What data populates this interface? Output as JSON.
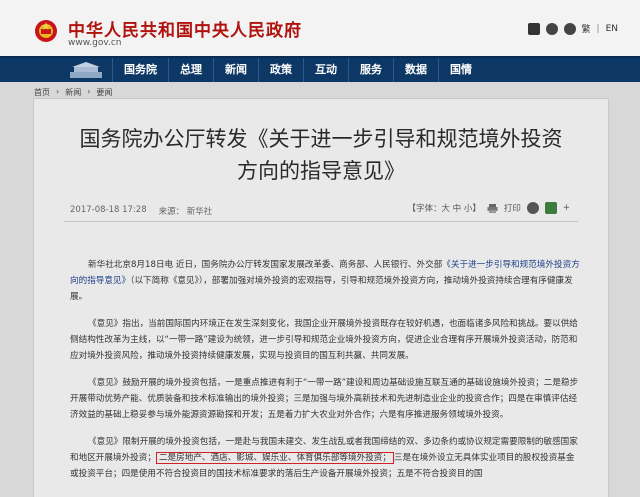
{
  "header": {
    "title": "中华人民共和国中央人民政府",
    "url": "www.gov.cn",
    "tools": {
      "lang_label": "繁",
      "lang_en": "EN"
    }
  },
  "nav": {
    "items": [
      {
        "label": "国务院"
      },
      {
        "label": "总理"
      },
      {
        "label": "新闻"
      },
      {
        "label": "政策"
      },
      {
        "label": "互动"
      },
      {
        "label": "服务"
      },
      {
        "label": "数据"
      },
      {
        "label": "国情"
      }
    ]
  },
  "breadcrumb": {
    "items": [
      "首页",
      "新闻",
      "要闻"
    ]
  },
  "article": {
    "title_line1": "国务院办公厅转发《关于进一步引导和规范境外投资",
    "title_line2": "方向的指导意见》",
    "date": "2017-08-18 17:28",
    "source": "来源： 新华社",
    "font_label": "【字体：大 中 小】",
    "print_label": "打印",
    "paragraphs": {
      "p1_text": "新华社北京8月18日电 近日，国务院办公厅转发国家发展改革委、商务部、人民银行、外交部",
      "p1_link": "《关于进一步引导和规范境外投资方向的指导意见》",
      "p1_text2": "（以下简称《意见》），部署加强对境外投资的宏观指导，引导和规范境外投资方向，推动境外投资持续合理有序健康发展。",
      "p2": "《意见》指出，当前国际国内环境正在发生深刻变化，我国企业开展境外投资既存在较好机遇，也面临诸多风险和挑战。要以供给侧结构性改革为主线，以“一带一路”建设为统领，进一步引导和规范企业境外投资方向，促进企业合理有序开展境外投资活动，防范和应对境外投资风险，推动境外投资持续健康发展，实现与投资目的国互利共赢、共同发展。",
      "p3": "《意见》鼓励开展的境外投资包括，一是重点推进有利于“一带一路”建设和周边基础设施互联互通的基础设施境外投资；二是稳步开展带动优势产能、优质装备和技术标准输出的境外投资；三是加强与境外高新技术和先进制造业企业的投资合作；四是在审慎评估经济效益的基础上稳妥参与境外能源资源勘探和开发；五是着力扩大农业对外合作；六是有序推进服务领域境外投资。",
      "p4_text": "《意见》限制开展的境外投资包括，一是赴与我国未建交、发生战乱或者我国缔结的双、多边条约或协议规定需要限制的敏感国家和地区开展境外投资；",
      "p4_highlight": "二是房地产、酒店、影城、娱乐业、体育俱乐部等境外投资；",
      "p4_text2": "三是在境外设立无具体实业项目的股权投资基金或投资平台；四是使用不符合投资目的国技术标准要求的落后生产设备开展境外投资；五是不符合投资目的国"
    }
  },
  "colors": {
    "brand_red": "#b0120e",
    "nav_blue": "#0d3866",
    "highlight_red": "#d0202a"
  }
}
